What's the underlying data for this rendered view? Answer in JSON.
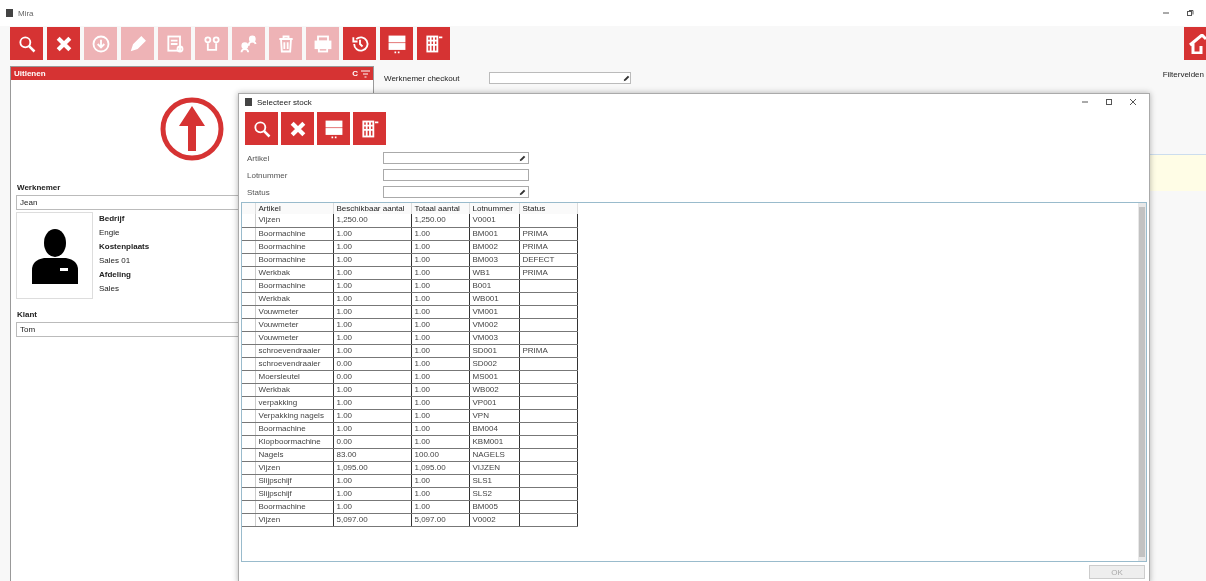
{
  "window": {
    "title": "Mira"
  },
  "toolbar": [
    {
      "kind": "search",
      "disabled": false
    },
    {
      "kind": "close",
      "disabled": false
    },
    {
      "kind": "download",
      "disabled": true
    },
    {
      "kind": "edit",
      "disabled": true
    },
    {
      "kind": "document",
      "disabled": true
    },
    {
      "kind": "route",
      "disabled": true
    },
    {
      "kind": "assign",
      "disabled": true
    },
    {
      "kind": "delete",
      "disabled": true
    },
    {
      "kind": "print",
      "disabled": true
    },
    {
      "kind": "history",
      "disabled": false
    },
    {
      "kind": "layout",
      "disabled": false
    },
    {
      "kind": "columns",
      "disabled": false
    }
  ],
  "filter_label": "Filtervelden",
  "panel": {
    "title": "Uitlenen",
    "shortcut": "C",
    "employee_label": "Werknemer",
    "employee": "Jean",
    "details": [
      {
        "kind": "label",
        "text": "Bedrijf"
      },
      {
        "kind": "value",
        "text": "Engie"
      },
      {
        "kind": "label",
        "text": "Kostenplaats"
      },
      {
        "kind": "value",
        "text": "Sales 01"
      },
      {
        "kind": "label",
        "text": "Afdeling"
      },
      {
        "kind": "value",
        "text": "Sales"
      }
    ],
    "client_label": "Klant",
    "client": "Tom"
  },
  "checkout": {
    "label": "Werknemer checkout",
    "editable": true
  },
  "dialog": {
    "title": "Selecteer stock",
    "toolbar": [
      {
        "kind": "search",
        "disabled": false
      },
      {
        "kind": "close",
        "disabled": false
      },
      {
        "kind": "layout",
        "disabled": false
      },
      {
        "kind": "columns",
        "disabled": false
      }
    ],
    "fields": [
      {
        "label": "Artikel",
        "editable": true
      },
      {
        "label": "Lotnummer",
        "editable": false
      },
      {
        "label": "Status",
        "editable": true
      }
    ],
    "columns": [
      "Artikel",
      "Beschikbaar aantal",
      "Totaal aantal",
      "Lotnummer",
      "Status"
    ],
    "rows": [
      {
        "artikel": "Vijzen",
        "beschikbaar": "1,250.00",
        "totaal": "1,250.00",
        "lot": "V0001"
      },
      {
        "artikel": "Boormachine",
        "beschikbaar": "1.00",
        "totaal": "1.00",
        "lot": "BM001",
        "status": "PRIMA"
      },
      {
        "artikel": "Boormachine",
        "beschikbaar": "1.00",
        "totaal": "1.00",
        "lot": "BM002",
        "status": "PRIMA"
      },
      {
        "artikel": "Boormachine",
        "beschikbaar": "1.00",
        "totaal": "1.00",
        "lot": "BM003",
        "status": "DEFECT"
      },
      {
        "artikel": "Werkbak",
        "beschikbaar": "1.00",
        "totaal": "1.00",
        "lot": "WB1",
        "status": "PRIMA"
      },
      {
        "artikel": "Boormachine",
        "beschikbaar": "1.00",
        "totaal": "1.00",
        "lot": "B001"
      },
      {
        "artikel": "Werkbak",
        "beschikbaar": "1.00",
        "totaal": "1.00",
        "lot": "WB001"
      },
      {
        "artikel": "Vouwmeter",
        "beschikbaar": "1.00",
        "totaal": "1.00",
        "lot": "VM001"
      },
      {
        "artikel": "Vouwmeter",
        "beschikbaar": "1.00",
        "totaal": "1.00",
        "lot": "VM002"
      },
      {
        "artikel": "Vouwmeter",
        "beschikbaar": "1.00",
        "totaal": "1.00",
        "lot": "VM003"
      },
      {
        "artikel": "schroevendraaier",
        "beschikbaar": "1.00",
        "totaal": "1.00",
        "lot": "SD001",
        "status": "PRIMA"
      },
      {
        "artikel": "schroevendraaier",
        "beschikbaar": "0.00",
        "totaal": "1.00",
        "lot": "SD002"
      },
      {
        "artikel": "Moersleutel",
        "beschikbaar": "0.00",
        "totaal": "1.00",
        "lot": "MS001"
      },
      {
        "artikel": "Werkbak",
        "beschikbaar": "1.00",
        "totaal": "1.00",
        "lot": "WB002"
      },
      {
        "artikel": "verpakking",
        "beschikbaar": "1.00",
        "totaal": "1.00",
        "lot": "VP001"
      },
      {
        "artikel": "Verpakking nagels",
        "beschikbaar": "1.00",
        "totaal": "1.00",
        "lot": "VPN"
      },
      {
        "artikel": "Boormachine",
        "beschikbaar": "1.00",
        "totaal": "1.00",
        "lot": "BM004"
      },
      {
        "artikel": "Klopboormachine",
        "beschikbaar": "0.00",
        "totaal": "1.00",
        "lot": "KBM001"
      },
      {
        "artikel": "Nagels",
        "beschikbaar": "83.00",
        "totaal": "100.00",
        "lot": "NAGELS"
      },
      {
        "artikel": "Vijzen",
        "beschikbaar": "1,095.00",
        "totaal": "1,095.00",
        "lot": "VIJZEN"
      },
      {
        "artikel": "Slijpschijf",
        "beschikbaar": "1.00",
        "totaal": "1.00",
        "lot": "SLS1"
      },
      {
        "artikel": "Slijpschijf",
        "beschikbaar": "1.00",
        "totaal": "1.00",
        "lot": "SLS2"
      },
      {
        "artikel": "Boormachine",
        "beschikbaar": "1.00",
        "totaal": "1.00",
        "lot": "BM005"
      },
      {
        "artikel": "Vijzen",
        "beschikbaar": "5,097.00",
        "totaal": "5,097.00",
        "lot": "V0002"
      }
    ],
    "ok_button": {
      "label": "OK",
      "disabled": true
    }
  }
}
